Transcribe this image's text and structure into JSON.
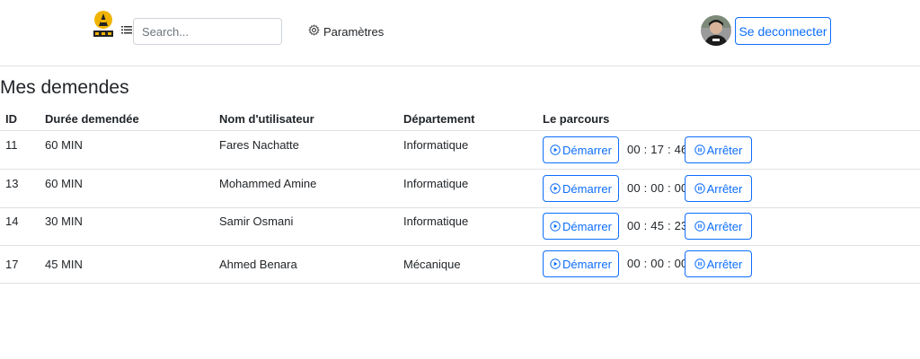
{
  "nav": {
    "search_placeholder": "Search...",
    "settings_label": "Paramètres",
    "logout_label": "Se deconnecter"
  },
  "page": {
    "title": "Mes demendes"
  },
  "table": {
    "headers": {
      "id": "ID",
      "duration": "Durée demendée",
      "username": "Nom d'utilisateur",
      "department": "Département",
      "route": "Le parcours"
    },
    "start_label": "Démarrer",
    "stop_label": "Arrêter",
    "rows": [
      {
        "id": "11",
        "duration": "60 MIN",
        "username": "Fares Nachatte",
        "department": "Informatique",
        "timer": "00 : 17 : 46"
      },
      {
        "id": "13",
        "duration": "60 MIN",
        "username": "Mohammed Amine",
        "department": "Informatique",
        "timer": "00 : 00 : 00"
      },
      {
        "id": "14",
        "duration": "30 MIN",
        "username": "Samir Osmani",
        "department": "Informatique",
        "timer": "00 : 45 : 23"
      },
      {
        "id": "17",
        "duration": "45 MIN",
        "username": "Ahmed Benara",
        "department": "Mécanique",
        "timer": "00 : 00 : 00"
      }
    ]
  },
  "colors": {
    "primary": "#0d6efd",
    "border": "#dee2e6",
    "text": "#212529"
  },
  "icons": {
    "logo": "logo-icon",
    "list": "list-icon",
    "settings": "gear-icon",
    "play": "play-circle-icon",
    "pause": "pause-circle-icon",
    "avatar": "avatar"
  }
}
